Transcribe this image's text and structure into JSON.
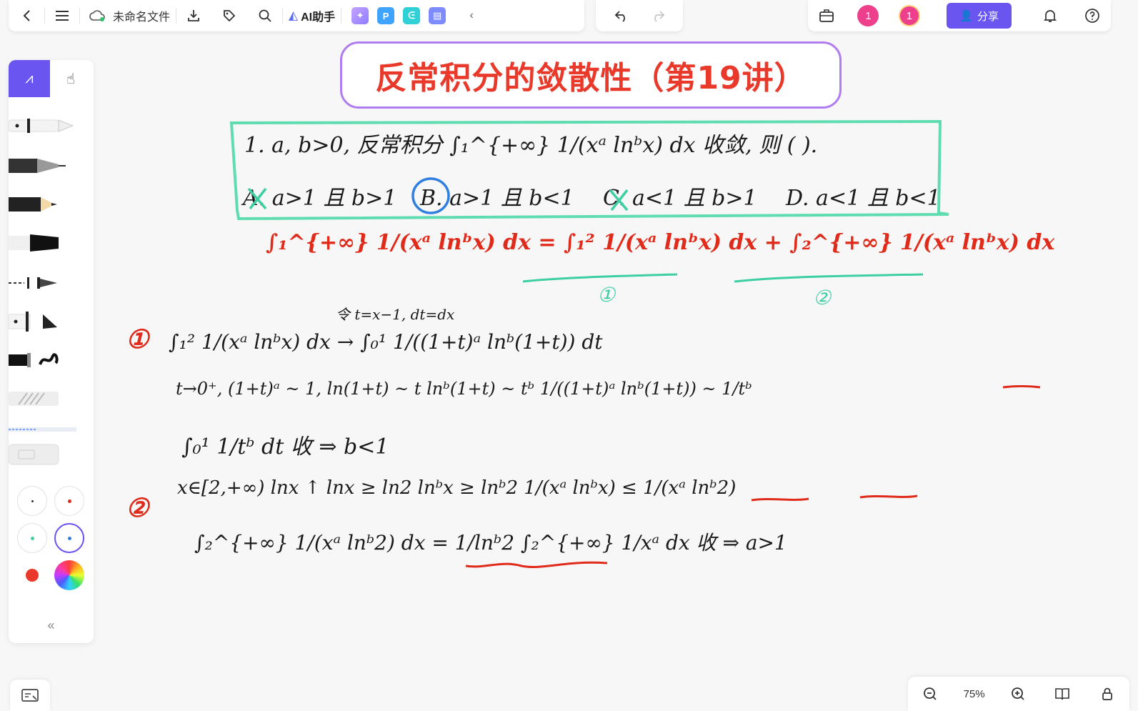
{
  "toolbar": {
    "filename": "未命名文件",
    "ai_label": "AI助手",
    "share_label": "分享",
    "badge_count": "1",
    "avatar_count": "1"
  },
  "colors": {
    "accent": "#6a55f0",
    "title_red": "#e8392a",
    "frame_purple": "#b07cf0",
    "frame_green": "#5fdcb0",
    "ink_red": "#e02b1b",
    "ink_blue": "#2f7fe0"
  },
  "canvas": {
    "title": "反常积分的敛散性（第19讲）",
    "question": {
      "line1": "1. a, b>0, 反常积分 ∫₁^{+∞} 1/(xᵃ lnᵇx) dx 收敛, 则 (   ).",
      "options": [
        "A. a>1 且 b>1",
        "B. a>1 且 b<1",
        "C. a<1 且 b>1",
        "D. a<1 且 b<1"
      ]
    },
    "split_eq": "∫₁^{+∞} 1/(xᵃ lnᵇx) dx = ∫₁² 1/(xᵃ lnᵇx) dx + ∫₂^{+∞} 1/(xᵃ lnᵇx) dx",
    "label1": "①",
    "label2": "②",
    "part1": {
      "sub": "令 t=x−1, dt=dx",
      "line1": "∫₁² 1/(xᵃ lnᵇx) dx  →  ∫₀¹ 1/((1+t)ᵃ lnᵇ(1+t)) dt",
      "line2": "t→0⁺, (1+t)ᵃ ~ 1, ln(1+t) ~ t   lnᵇ(1+t) ~ tᵇ   1/((1+t)ᵃ lnᵇ(1+t)) ~ 1/tᵇ",
      "line3": "∫₀¹ 1/tᵇ dt 收 ⇒ b<1"
    },
    "part2": {
      "line1": "x∈[2,+∞)  lnx ↑   lnx ≥ ln2   lnᵇx ≥ lnᵇ2   1/(xᵃ lnᵇx) ≤ 1/(xᵃ lnᵇ2)",
      "line2": "∫₂^{+∞} 1/(xᵃ lnᵇ2) dx = 1/lnᵇ2 ∫₂^{+∞} 1/xᵃ dx 收 ⇒ a>1"
    }
  },
  "bottom": {
    "zoom": "75%"
  }
}
